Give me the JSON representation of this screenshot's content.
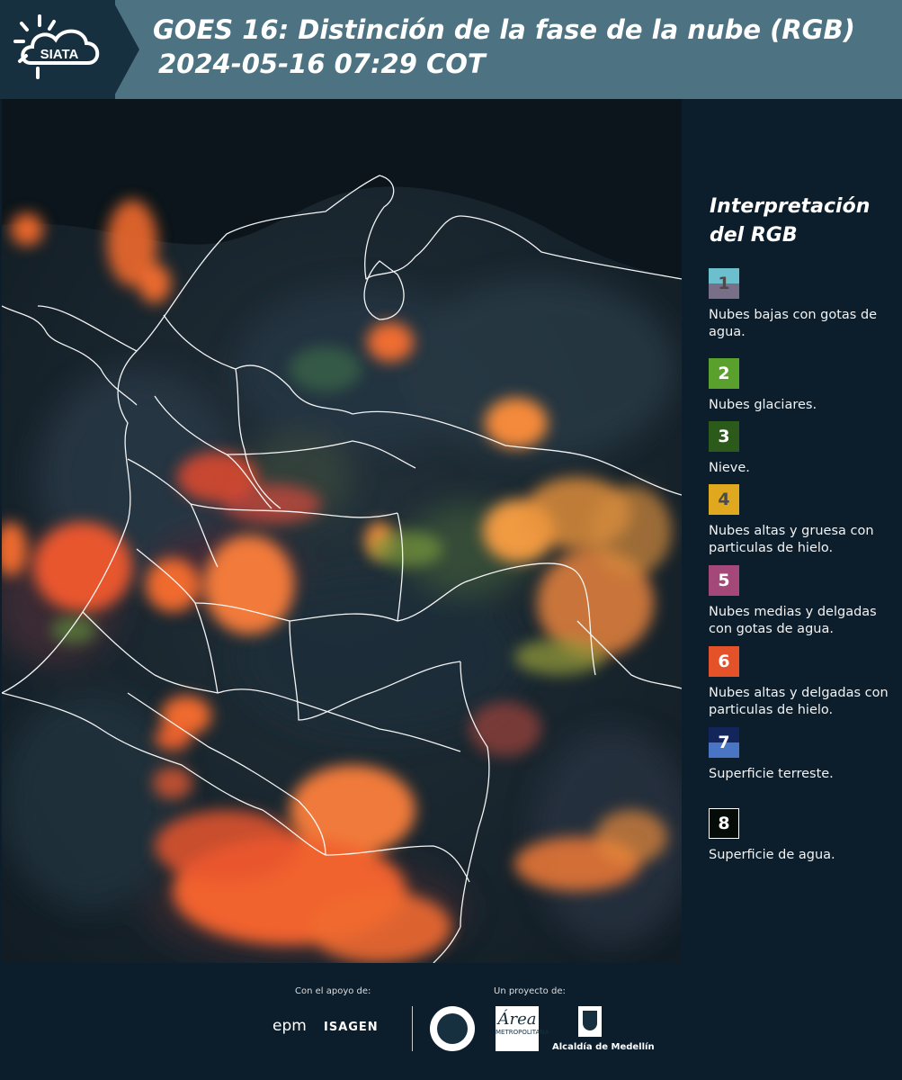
{
  "header": {
    "logo_text": "SIATA",
    "title_line1": "GOES 16: Distinción de la fase de la nube (RGB)",
    "title_line2": "2024-05-16 07:29 COT"
  },
  "legend": {
    "title": "Interpretación del RGB",
    "items": [
      {
        "number": "1",
        "label": "Nubes bajas con gotas de agua.",
        "top_color": "#6cbfcd",
        "bottom_color": "#7a6f89",
        "number_color": "#4a4a4a"
      },
      {
        "number": "2",
        "label": "Nubes glaciares.",
        "top_color": "#5aa02c",
        "bottom_color": "#5aa02c",
        "number_color": "#ffffff"
      },
      {
        "number": "3",
        "label": "Nieve.",
        "top_color": "#2c5a1a",
        "bottom_color": "#2c5a1a",
        "number_color": "#ffffff"
      },
      {
        "number": "4",
        "label": "Nubes altas y gruesa con particulas de hielo.",
        "top_color": "#e0a81e",
        "bottom_color": "#e0a81e",
        "number_color": "#4a4a4a"
      },
      {
        "number": "5",
        "label": "Nubes medias y delgadas con gotas de agua.",
        "top_color": "#a4487a",
        "bottom_color": "#a4487a",
        "number_color": "#ffffff"
      },
      {
        "number": "6",
        "label": "Nubes altas y delgadas con particulas de hielo.",
        "top_color": "#e4522a",
        "bottom_color": "#e4522a",
        "number_color": "#ffffff"
      },
      {
        "number": "7",
        "label": "Superficie terreste.",
        "top_color": "#13265c",
        "bottom_color": "#4a74c4",
        "number_color": "#ffffff"
      },
      {
        "number": "8",
        "label": "Superficie de agua.",
        "top_color": "#050b06",
        "bottom_color": "#050b06",
        "number_color": "#ffffff"
      }
    ]
  },
  "footer": {
    "support_label": "Con el apoyo de:",
    "project_label": "Un proyecto de:",
    "epm": "epm",
    "isagen": "ISAGEN",
    "amva": "Área",
    "amva_sub": "METROPOLITANA",
    "medellin": "Alcaldía de Medellín"
  },
  "colors": {
    "header_bg": "#4d7382",
    "page_bg": "#0c1e2c",
    "cloud_orange": "#f26a2e"
  }
}
